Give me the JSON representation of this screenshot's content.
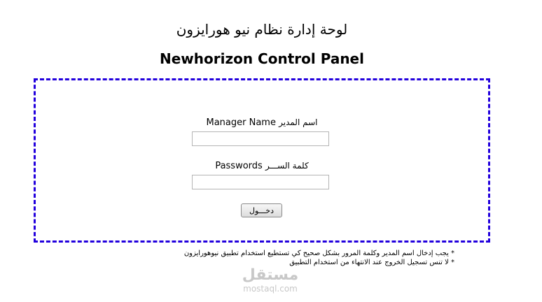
{
  "header": {
    "title_ar": "لوحة إدارة نظام نيو هورايزون",
    "title_en": "Newhorizon Control Panel"
  },
  "form": {
    "manager_label_ar": "اسم المدير",
    "manager_label_en": "Manager Name",
    "manager_value": "",
    "password_label_ar": "كلمة الســـر",
    "password_label_en": "Passwords",
    "password_value": "",
    "login_button": "دخـــول",
    "border_color": "#2200dd"
  },
  "notes": [
    "* يجب إدخال اسم المدير وكلمة المرور بشكل صحيح كي تستطيع استخدام تطبيق نيوهورايزون",
    "* لا تنس تسجيل الخروج عند الانتهاء من استخدام التطبيق"
  ],
  "watermark": {
    "text_ar": "مستقل",
    "text_en": "mostaql.com"
  }
}
